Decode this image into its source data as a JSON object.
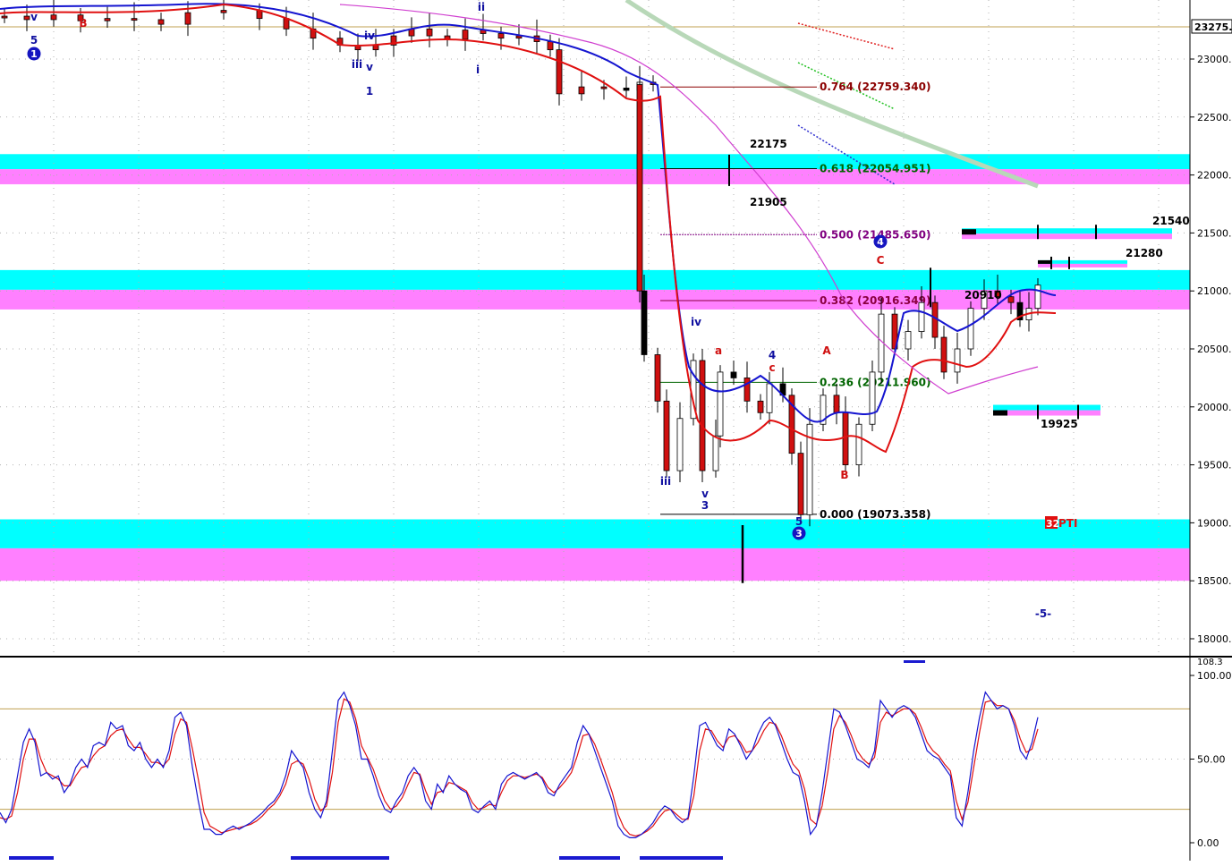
{
  "colors": {
    "background": "#ffffff",
    "cyan_band": "#00ffff",
    "magenta_band": "#ff80ff",
    "ma_blue": "#1515d0",
    "ma_red": "#e01010",
    "ma_magenta": "#d040d0",
    "trend_gray_green": "#b8d8b8",
    "fib_764": "#8b0000",
    "fib_618": "#006400",
    "fib_500": "#800080",
    "fib_382": "#8b0040",
    "fib_236": "#006400",
    "fib_000": "#000000",
    "wave_blue": "#1010a0",
    "wave_red": "#d01010",
    "stoch_blue": "#1515d0",
    "stoch_red": "#e01010",
    "stoch_ref_line": "#c0a050",
    "grid": "#b0b0b0"
  },
  "chart_data": [
    {
      "type": "candlestick",
      "title": "",
      "yaxis": {
        "ylim": [
          17850,
          23500
        ],
        "ticks": [
          "23000.",
          "22500.",
          "22000.",
          "21500.",
          "21000.",
          "20500.",
          "20000.",
          "19500.",
          "19000.",
          "18500.",
          "18000."
        ],
        "tick_values": [
          23000,
          22500,
          22000,
          21500,
          21000,
          20500,
          20000,
          19500,
          19000,
          18500,
          18000
        ],
        "last_price_label": "23275."
      },
      "grid": "dotted",
      "zones": [
        {
          "color": "cyan",
          "range": [
            22050,
            22180
          ]
        },
        {
          "color": "magenta",
          "range": [
            21920,
            22050
          ]
        },
        {
          "color": "cyan",
          "range": [
            21010,
            21180
          ]
        },
        {
          "color": "magenta",
          "range": [
            20840,
            21010
          ]
        },
        {
          "color": "cyan",
          "range": [
            18780,
            19030
          ]
        },
        {
          "color": "magenta",
          "range": [
            18500,
            18780
          ]
        }
      ],
      "fib_levels": [
        {
          "ratio": "0.764",
          "price": "22759.340",
          "label": "0.764 (22759.340)",
          "value": 22759.34
        },
        {
          "ratio": "0.618",
          "price": "22054.951",
          "label": "0.618 (22054.951)",
          "value": 22054.951
        },
        {
          "ratio": "0.500",
          "price": "21485.650",
          "label": "0.500 (21485.650)",
          "value": 21485.65
        },
        {
          "ratio": "0.382",
          "price": "20916.349",
          "label": "0.382 (20916.349)",
          "value": 20916.349
        },
        {
          "ratio": "0.236",
          "price": "20211.960",
          "label": "0.236 (20211.960)",
          "value": 20211.96
        },
        {
          "ratio": "0.000",
          "price": "19073.358",
          "label": "0.000 (19073.358)",
          "value": 19073.358
        }
      ],
      "price_labels": [
        {
          "text": "22175",
          "value": 22175
        },
        {
          "text": "21905",
          "value": 21905
        },
        {
          "text": "21540",
          "value": 21540
        },
        {
          "text": "21280",
          "value": 21280
        },
        {
          "text": "20910",
          "value": 20910
        },
        {
          "text": "19925",
          "value": 19925
        }
      ],
      "wave_labels": [
        {
          "text": "v",
          "color": "blue"
        },
        {
          "text": "5",
          "color": "blue"
        },
        {
          "text": "1",
          "color": "blue",
          "circled": true
        },
        {
          "text": "B",
          "color": "red"
        },
        {
          "text": "iii",
          "color": "blue"
        },
        {
          "text": "v",
          "color": "blue"
        },
        {
          "text": "iv",
          "color": "blue"
        },
        {
          "text": "1",
          "color": "blue"
        },
        {
          "text": "ii",
          "color": "blue"
        },
        {
          "text": "i",
          "color": "blue"
        },
        {
          "text": "iv",
          "color": "blue"
        },
        {
          "text": "iii",
          "color": "blue"
        },
        {
          "text": "v",
          "color": "blue"
        },
        {
          "text": "3",
          "color": "blue"
        },
        {
          "text": "a",
          "color": "red"
        },
        {
          "text": "4",
          "color": "blue"
        },
        {
          "text": "c",
          "color": "red"
        },
        {
          "text": "5",
          "color": "blue"
        },
        {
          "text": "3",
          "color": "blue",
          "circled": true
        },
        {
          "text": "A",
          "color": "red"
        },
        {
          "text": "B",
          "color": "red"
        },
        {
          "text": "C",
          "color": "red"
        },
        {
          "text": "4",
          "color": "blue",
          "circled": true
        },
        {
          "text": "-5-",
          "color": "blue"
        }
      ],
      "badge": {
        "number": "32",
        "text": "PTI"
      }
    },
    {
      "type": "line",
      "title": "",
      "yaxis": {
        "ylim": [
          -8,
          108
        ],
        "ticks": [
          "100.00",
          "50.00",
          "0.00"
        ],
        "tick_values": [
          100,
          50,
          0
        ],
        "top_label": "108.3"
      },
      "reference_lines": [
        80,
        20
      ],
      "series": [
        {
          "color": "blue",
          "values": [
            18,
            12,
            20,
            40,
            60,
            68,
            60,
            40,
            42,
            38,
            40,
            30,
            35,
            45,
            50,
            45,
            58,
            60,
            58,
            72,
            68,
            70,
            58,
            55,
            60,
            50,
            45,
            50,
            45,
            55,
            75,
            78,
            70,
            45,
            25,
            8,
            8,
            5,
            5,
            8,
            10,
            8,
            10,
            12,
            15,
            18,
            22,
            25,
            30,
            40,
            55,
            50,
            45,
            30,
            20,
            15,
            25,
            55,
            85,
            90,
            82,
            70,
            50,
            50,
            40,
            28,
            20,
            18,
            25,
            30,
            40,
            45,
            40,
            25,
            20,
            35,
            30,
            40,
            35,
            32,
            30,
            20,
            18,
            22,
            25,
            20,
            35,
            40,
            42,
            40,
            38,
            40,
            42,
            38,
            30,
            28,
            35,
            40,
            45,
            60,
            70,
            65,
            55,
            45,
            35,
            25,
            10,
            5,
            3,
            3,
            5,
            8,
            12,
            18,
            22,
            20,
            15,
            12,
            15,
            40,
            70,
            72,
            65,
            58,
            55,
            68,
            65,
            58,
            50,
            55,
            65,
            72,
            75,
            70,
            60,
            50,
            42,
            40,
            25,
            5,
            10,
            30,
            55,
            80,
            78,
            70,
            60,
            50,
            48,
            45,
            55,
            85,
            80,
            75,
            80,
            82,
            80,
            75,
            65,
            55,
            52,
            50,
            45,
            40,
            15,
            10,
            30,
            55,
            75,
            90,
            85,
            80,
            82,
            80,
            70,
            55,
            50,
            60,
            75
          ]
        },
        {
          "color": "red",
          "values": [
            15,
            14,
            16,
            30,
            50,
            62,
            62,
            50,
            42,
            40,
            38,
            34,
            34,
            40,
            45,
            46,
            52,
            56,
            58,
            64,
            67,
            68,
            62,
            57,
            57,
            53,
            48,
            48,
            46,
            50,
            65,
            74,
            72,
            56,
            38,
            18,
            10,
            8,
            6,
            7,
            8,
            9,
            10,
            11,
            13,
            16,
            20,
            23,
            28,
            35,
            47,
            49,
            47,
            38,
            26,
            19,
            22,
            42,
            72,
            86,
            84,
            74,
            58,
            51,
            44,
            34,
            25,
            20,
            22,
            27,
            35,
            42,
            41,
            31,
            23,
            30,
            31,
            36,
            35,
            33,
            31,
            24,
            20,
            21,
            23,
            22,
            30,
            37,
            40,
            40,
            39,
            40,
            41,
            39,
            33,
            30,
            33,
            37,
            42,
            52,
            64,
            65,
            59,
            50,
            40,
            30,
            17,
            9,
            5,
            4,
            5,
            7,
            10,
            15,
            19,
            20,
            17,
            14,
            14,
            28,
            55,
            68,
            67,
            61,
            57,
            63,
            64,
            60,
            54,
            55,
            60,
            67,
            72,
            71,
            64,
            55,
            47,
            43,
            32,
            14,
            11,
            22,
            43,
            68,
            76,
            72,
            64,
            55,
            50,
            47,
            51,
            72,
            78,
            76,
            78,
            80,
            80,
            77,
            69,
            60,
            55,
            52,
            47,
            43,
            25,
            14,
            24,
            45,
            66,
            84,
            85,
            82,
            82,
            80,
            73,
            62,
            54,
            56,
            68
          ]
        }
      ]
    }
  ]
}
